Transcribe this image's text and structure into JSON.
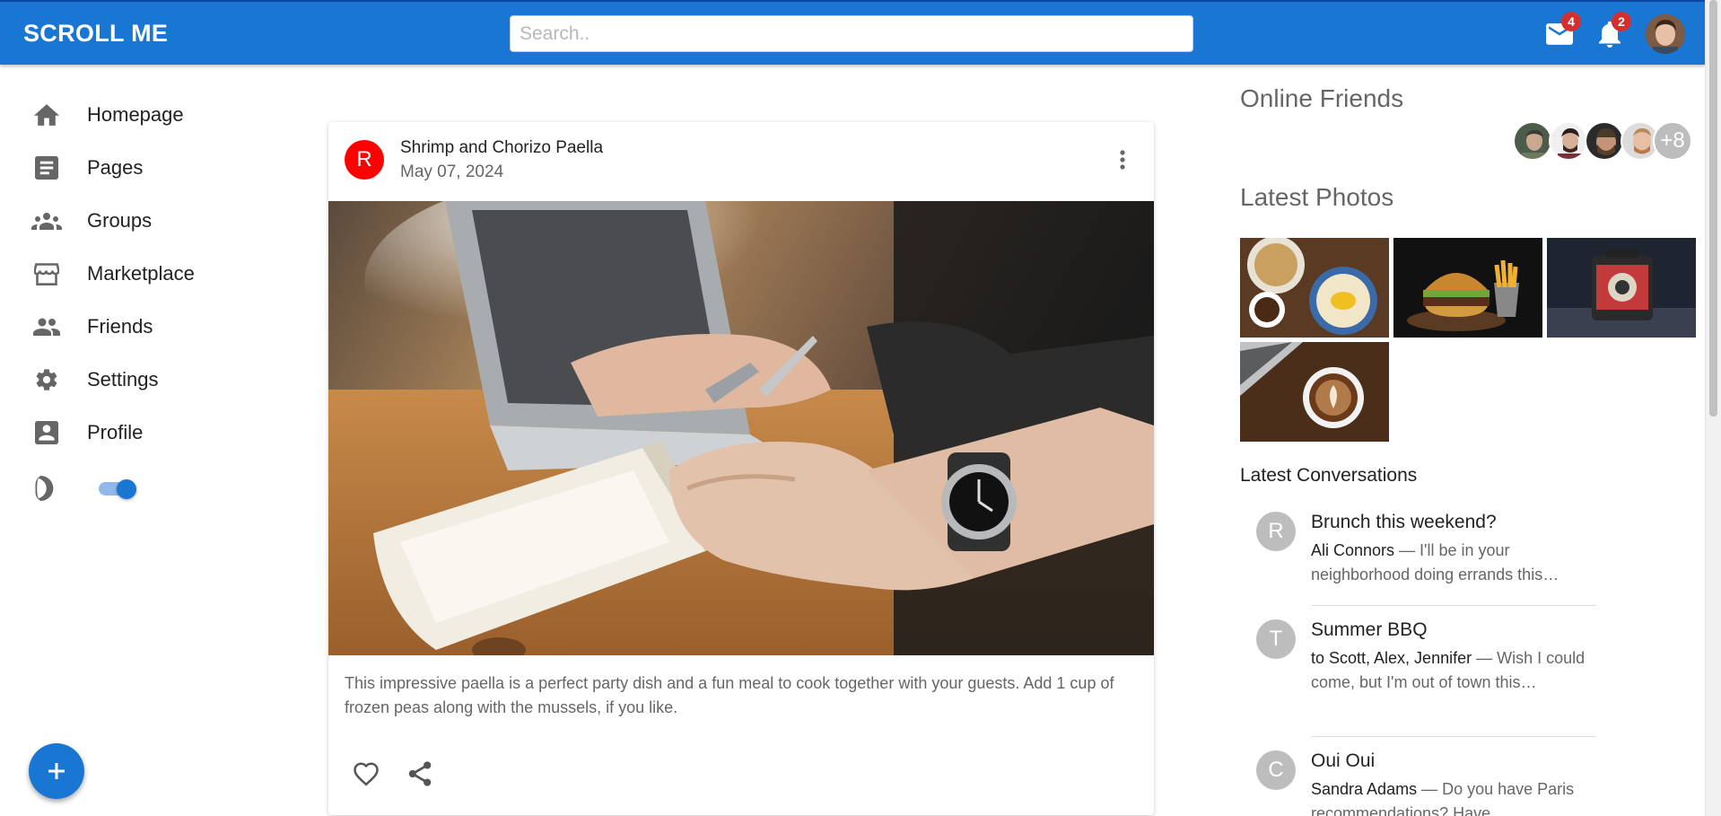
{
  "app": {
    "title": "SCROLL ME",
    "search_placeholder": "Search..",
    "mail_count": "4",
    "notification_count": "2",
    "accent_color": "#1976d2"
  },
  "sidebar": {
    "items": [
      {
        "label": "Homepage",
        "icon": "home-icon"
      },
      {
        "label": "Pages",
        "icon": "article-icon"
      },
      {
        "label": "Groups",
        "icon": "groups-icon"
      },
      {
        "label": "Marketplace",
        "icon": "storefront-icon"
      },
      {
        "label": "Friends",
        "icon": "people-icon"
      },
      {
        "label": "Settings",
        "icon": "gear-icon"
      },
      {
        "label": "Profile",
        "icon": "account-box-icon"
      }
    ],
    "dark_mode_icon": "moon-icon",
    "dark_mode_toggle": "on",
    "fab_icon": "plus-icon"
  },
  "post": {
    "avatar_letter": "R",
    "avatar_color": "#ff0000",
    "title": "Shrimp and Chorizo Paella",
    "date": "May 07, 2024",
    "text": "This impressive paella is a perfect party dish and a fun meal to cook together with your guests. Add 1 cup of frozen peas along with the mussels, if you like."
  },
  "right": {
    "online_friends_heading": "Online Friends",
    "online_more": "+8",
    "latest_photos_heading": "Latest Photos",
    "latest_conversations_heading": "Latest Conversations",
    "conversations": [
      {
        "letter": "R",
        "subject": "Brunch this weekend?",
        "from": "Ali Connors",
        "snippet": " — I'll be in your neighborhood doing errands this…"
      },
      {
        "letter": "T",
        "subject": "Summer BBQ",
        "from": "to Scott, Alex, Jennifer",
        "snippet": " — Wish I could come, but I'm out of town this…"
      },
      {
        "letter": "C",
        "subject": "Oui Oui",
        "from": "Sandra Adams",
        "snippet": " — Do you have Paris recommendations? Have…"
      }
    ]
  }
}
